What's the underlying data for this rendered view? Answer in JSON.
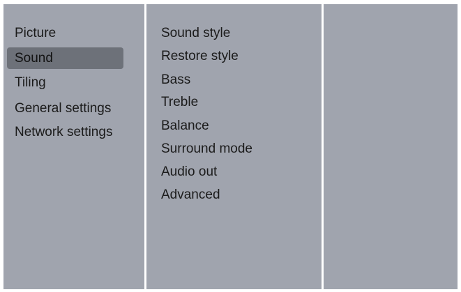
{
  "main_menu": {
    "items": [
      {
        "label": "Picture",
        "selected": false
      },
      {
        "label": "Sound",
        "selected": true
      },
      {
        "label": "Tiling",
        "selected": false
      },
      {
        "label": "General settings",
        "selected": false
      },
      {
        "label": "Network settings",
        "selected": false
      }
    ]
  },
  "sound_menu": {
    "items": [
      {
        "label": "Sound style"
      },
      {
        "label": "Restore style"
      },
      {
        "label": "Bass"
      },
      {
        "label": "Treble"
      },
      {
        "label": "Balance"
      },
      {
        "label": "Surround mode"
      },
      {
        "label": "Audio out"
      },
      {
        "label": "Advanced"
      }
    ]
  },
  "colors": {
    "panel": "#a0a4ae",
    "highlight": "#6d7179",
    "divider": "#ffffff",
    "text": "#1b1b1b"
  }
}
